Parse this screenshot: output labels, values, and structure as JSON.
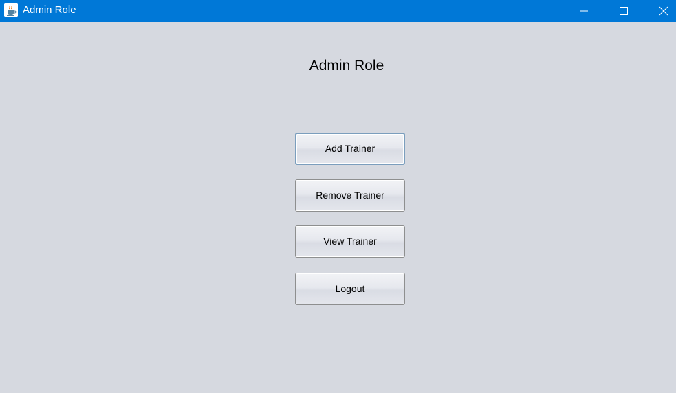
{
  "window": {
    "title": "Admin Role",
    "icon": "java-cup-icon"
  },
  "titlebar_controls": {
    "minimize": "minimize-icon",
    "maximize": "maximize-icon",
    "close": "close-icon"
  },
  "main": {
    "heading": "Admin Role",
    "buttons": [
      {
        "label": "Add Trainer"
      },
      {
        "label": "Remove Trainer"
      },
      {
        "label": "View Trainer"
      },
      {
        "label": "Logout"
      }
    ]
  },
  "colors": {
    "titlebar": "#0078d7",
    "background": "#d6d9e0",
    "focus_border": "#7b9ebd"
  }
}
